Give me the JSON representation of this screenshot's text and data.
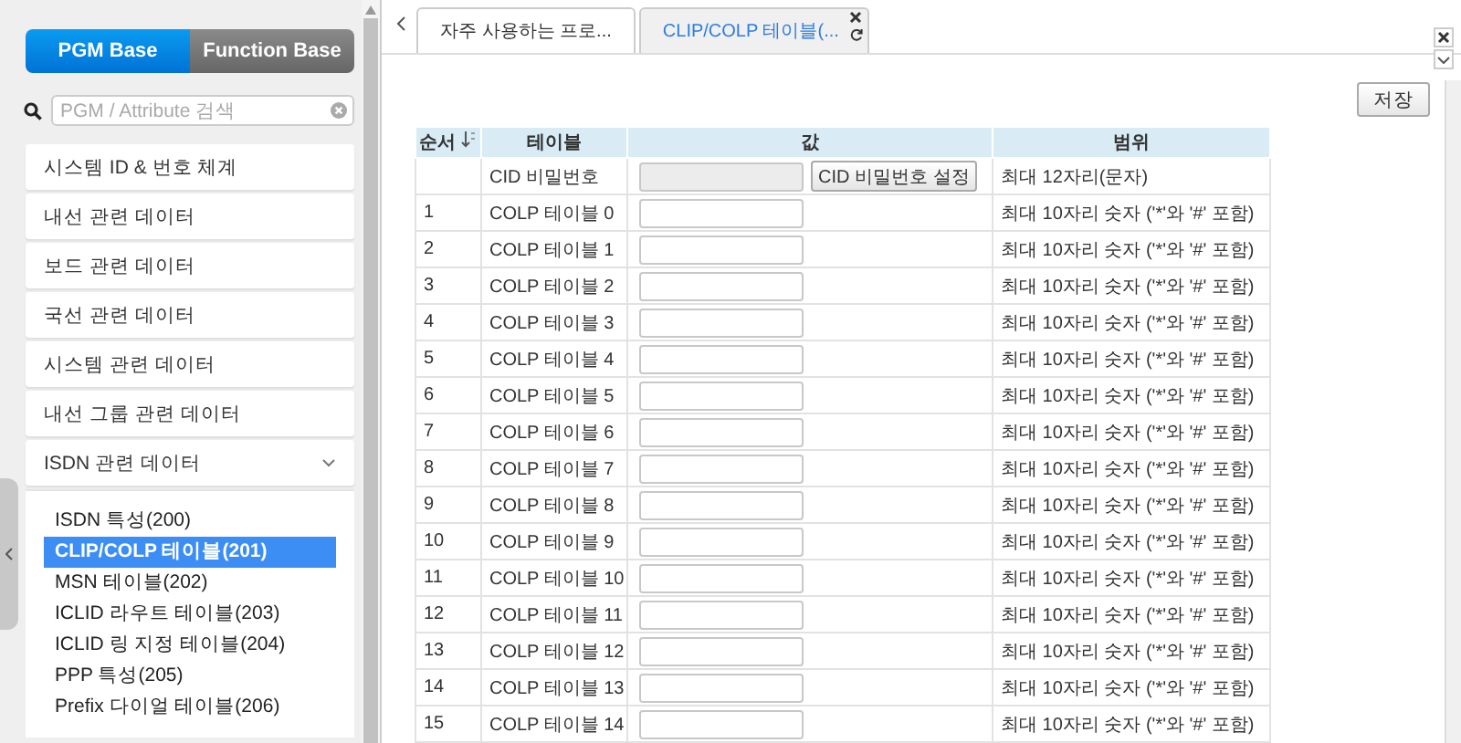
{
  "sidebar": {
    "mode_buttons": [
      {
        "label": "PGM Base",
        "selected": true
      },
      {
        "label": "Function Base",
        "selected": false
      }
    ],
    "search": {
      "placeholder": "PGM / Attribute 검색"
    },
    "menu": [
      {
        "label": "시스템 ID & 번호 체계",
        "expanded": false
      },
      {
        "label": "내선 관련 데이터",
        "expanded": false
      },
      {
        "label": "보드 관련 데이터",
        "expanded": false
      },
      {
        "label": "국선 관련 데이터",
        "expanded": false
      },
      {
        "label": "시스템 관련 데이터",
        "expanded": false
      },
      {
        "label": "내선 그룹 관련 데이터",
        "expanded": false
      },
      {
        "label": "ISDN 관련 데이터",
        "expanded": true,
        "children": [
          {
            "label": "ISDN 특성(200)",
            "selected": false
          },
          {
            "label": "CLIP/COLP 테이블(201)",
            "selected": true
          },
          {
            "label": "MSN 테이블(202)",
            "selected": false
          },
          {
            "label": "ICLID 라우트 테이블(203)",
            "selected": false
          },
          {
            "label": "ICLID 링 지정 테이블(204)",
            "selected": false
          },
          {
            "label": "PPP 특성(205)",
            "selected": false
          },
          {
            "label": "Prefix 다이얼 테이블(206)",
            "selected": false
          }
        ]
      }
    ]
  },
  "tabs": [
    {
      "label": "자주 사용하는 프로...",
      "selected": false
    },
    {
      "label": "CLIP/COLP 테이블(...",
      "selected": true
    }
  ],
  "save_button": "저장",
  "table": {
    "columns": [
      "순서",
      "테이블",
      "값",
      "범위"
    ],
    "password_row": {
      "name": "CID 비밀번호",
      "button": "CID 비밀번호 설정",
      "range": "최대 12자리(문자)"
    },
    "rows": [
      {
        "order": "1",
        "name": "COLP 테이블 0",
        "range": "최대 10자리 숫자 ('*'와 '#' 포함)"
      },
      {
        "order": "2",
        "name": "COLP 테이블 1",
        "range": "최대 10자리 숫자 ('*'와 '#' 포함)"
      },
      {
        "order": "3",
        "name": "COLP 테이블 2",
        "range": "최대 10자리 숫자 ('*'와 '#' 포함)"
      },
      {
        "order": "4",
        "name": "COLP 테이블 3",
        "range": "최대 10자리 숫자 ('*'와 '#' 포함)"
      },
      {
        "order": "5",
        "name": "COLP 테이블 4",
        "range": "최대 10자리 숫자 ('*'와 '#' 포함)"
      },
      {
        "order": "6",
        "name": "COLP 테이블 5",
        "range": "최대 10자리 숫자 ('*'와 '#' 포함)"
      },
      {
        "order": "7",
        "name": "COLP 테이블 6",
        "range": "최대 10자리 숫자 ('*'와 '#' 포함)"
      },
      {
        "order": "8",
        "name": "COLP 테이블 7",
        "range": "최대 10자리 숫자 ('*'와 '#' 포함)"
      },
      {
        "order": "9",
        "name": "COLP 테이블 8",
        "range": "최대 10자리 숫자 ('*'와 '#' 포함)"
      },
      {
        "order": "10",
        "name": "COLP 테이블 9",
        "range": "최대 10자리 숫자 ('*'와 '#' 포함)"
      },
      {
        "order": "11",
        "name": "COLP 테이블 10",
        "range": "최대 10자리 숫자 ('*'와 '#' 포함)"
      },
      {
        "order": "12",
        "name": "COLP 테이블 11",
        "range": "최대 10자리 숫자 ('*'와 '#' 포함)"
      },
      {
        "order": "13",
        "name": "COLP 테이블 12",
        "range": "최대 10자리 숫자 ('*'와 '#' 포함)"
      },
      {
        "order": "14",
        "name": "COLP 테이블 13",
        "range": "최대 10자리 숫자 ('*'와 '#' 포함)"
      },
      {
        "order": "15",
        "name": "COLP 테이블 14",
        "range": "최대 10자리 숫자 ('*'와 '#' 포함)"
      }
    ]
  }
}
